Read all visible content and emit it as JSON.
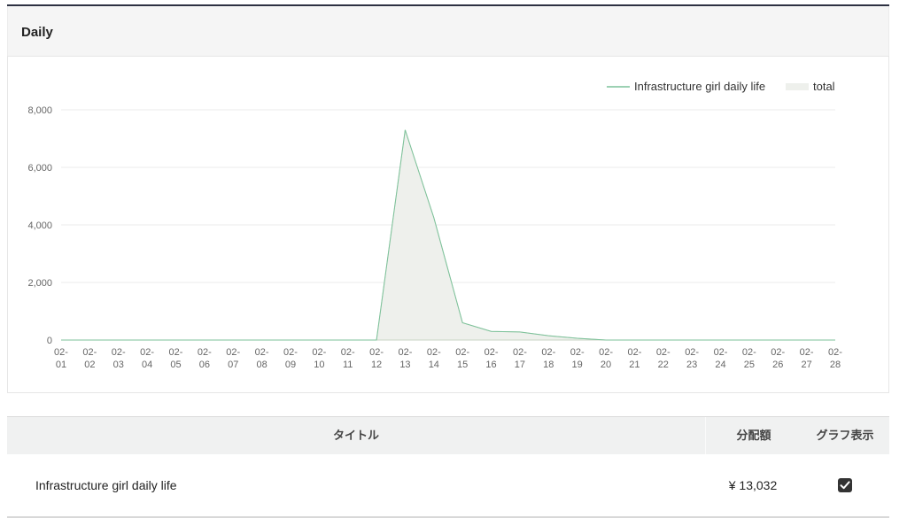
{
  "panel": {
    "title": "Daily"
  },
  "colors": {
    "series_line": "#7cc29a",
    "total_fill": "#eef0ec",
    "total_line": "#c8d6c4",
    "grid": "#ebebeb"
  },
  "chart_data": {
    "type": "area",
    "categories": [
      "02-01",
      "02-02",
      "02-03",
      "02-04",
      "02-05",
      "02-06",
      "02-07",
      "02-08",
      "02-09",
      "02-10",
      "02-11",
      "02-12",
      "02-13",
      "02-14",
      "02-15",
      "02-16",
      "02-17",
      "02-18",
      "02-19",
      "02-20",
      "02-21",
      "02-22",
      "02-23",
      "02-24",
      "02-25",
      "02-26",
      "02-27",
      "02-28"
    ],
    "series": [
      {
        "name": "Infrastructure girl daily life",
        "values": [
          0,
          0,
          0,
          0,
          0,
          0,
          0,
          0,
          0,
          0,
          0,
          0,
          7300,
          4250,
          600,
          300,
          280,
          150,
          60,
          0,
          0,
          0,
          0,
          0,
          0,
          0,
          0,
          0
        ]
      },
      {
        "name": "total",
        "values": [
          0,
          0,
          0,
          0,
          0,
          0,
          0,
          0,
          0,
          0,
          0,
          0,
          7300,
          4250,
          600,
          300,
          280,
          150,
          60,
          0,
          0,
          0,
          0,
          0,
          0,
          0,
          0,
          0
        ]
      }
    ],
    "yticks": [
      "0",
      "2,000",
      "4,000",
      "6,000",
      "8,000"
    ],
    "ylim": [
      0,
      8000
    ],
    "grid": true,
    "legend_position": "top-right"
  },
  "table": {
    "headers": {
      "title": "タイトル",
      "amount": "分配額",
      "graph": "グラフ表示"
    },
    "rows": [
      {
        "title": "Infrastructure girl daily life",
        "amount": "¥ 13,032",
        "graph_checked": true
      }
    ]
  }
}
